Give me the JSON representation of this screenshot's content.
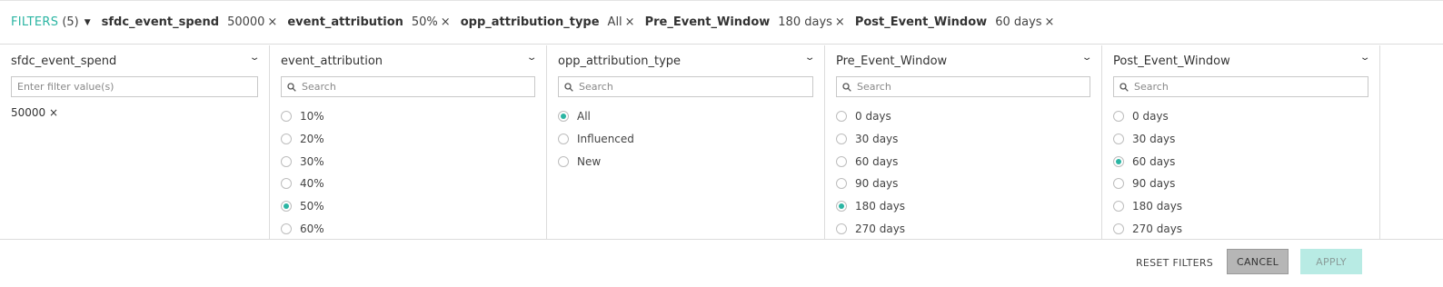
{
  "filter_bar": {
    "label": "FILTERS",
    "count": "(5)",
    "chips": [
      {
        "name": "sfdc_event_spend",
        "value": "50000"
      },
      {
        "name": "event_attribution",
        "value": "50%"
      },
      {
        "name": "opp_attribution_type",
        "value": "All"
      },
      {
        "name": "Pre_Event_Window",
        "value": "180 days"
      },
      {
        "name": "Post_Event_Window",
        "value": "60 days"
      }
    ],
    "remove_glyph": "×"
  },
  "panels": [
    {
      "title": "sfdc_event_spend",
      "placeholder": "Enter filter value(s)",
      "selected": "50000 ×"
    },
    {
      "title": "event_attribution",
      "placeholder": "Search",
      "options": [
        "10%",
        "20%",
        "30%",
        "40%",
        "50%",
        "60%"
      ],
      "selected": "50%"
    },
    {
      "title": "opp_attribution_type",
      "placeholder": "Search",
      "options": [
        "All",
        "Influenced",
        "New"
      ],
      "selected": "All"
    },
    {
      "title": "Pre_Event_Window",
      "placeholder": "Search",
      "options": [
        "0 days",
        "30 days",
        "60 days",
        "90 days",
        "180 days",
        "270 days"
      ],
      "selected": "180 days"
    },
    {
      "title": "Post_Event_Window",
      "placeholder": "Search",
      "options": [
        "0 days",
        "30 days",
        "60 days",
        "90 days",
        "180 days",
        "270 days"
      ],
      "selected": "60 days"
    }
  ],
  "footer": {
    "reset_label": "RESET FILTERS",
    "cancel_label": "CANCEL",
    "apply_label": "APPLY"
  },
  "colors": {
    "accent": "#2bb5a3",
    "apply_bg": "#b8ebe4",
    "cancel_bg": "#b6b6b6"
  }
}
